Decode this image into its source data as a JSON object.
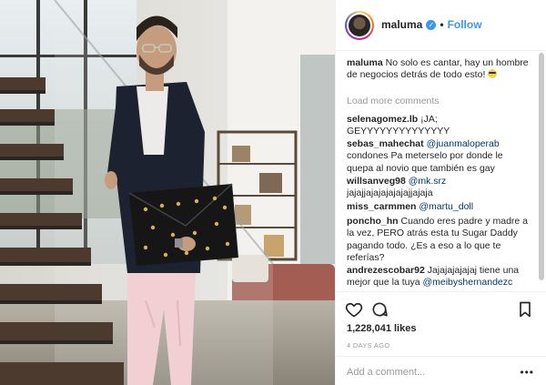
{
  "post": {
    "username": "maluma",
    "verified_badge": "✓",
    "separator": "•",
    "follow_label": "Follow"
  },
  "comments": [
    {
      "user": "maluma",
      "text": "No solo es cantar, hay un hombre de negocios detrás de todo esto! ",
      "emoji": "sunglasses-emoji"
    },
    {
      "user": "selenagomez.lb",
      "text": "¡JA; GEYYYYYYYYYYYYYY"
    },
    {
      "user": "sebas_mahechat",
      "mention": "@juanmaloperab",
      "text": "condones Pa meterselo por donde le quepa al novio que también es gay"
    },
    {
      "user": "willsanveg98",
      "mention": "@mk.srz",
      "text": "jajajjajajajajajajjajaja"
    },
    {
      "user": "miss_carmmen",
      "mention": "@martu_doll",
      "text": ""
    },
    {
      "user": "poncho_hn",
      "text": "Cuando eres padre y madre a la vez, PERO atrás esta tu Sugar Daddy pagando todo. ¿Es a eso a lo que te referías?"
    },
    {
      "user": "andrezescobar92",
      "text": "Jajajajajajaj tiene una mejor que la tuya ",
      "mention": "@meibyshernandezc"
    }
  ],
  "load_more_label": "Load more comments",
  "likes": "1,228,041 likes",
  "time_ago": "4 DAYS AGO",
  "add_comment_placeholder": "Add a comment...",
  "more_options": "•••",
  "colors": {
    "link_blue": "#3897f0",
    "mention_blue": "#003569",
    "muted_gray": "#999999",
    "text": "#262626"
  }
}
